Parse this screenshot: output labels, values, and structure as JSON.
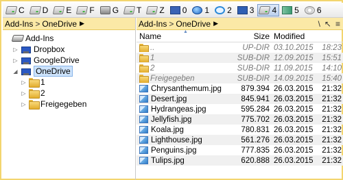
{
  "drives": [
    {
      "letter": "C",
      "icon": "hdd-icon"
    },
    {
      "letter": "D",
      "icon": "hdd-icon"
    },
    {
      "letter": "E",
      "icon": "hdd-icon"
    },
    {
      "letter": "F",
      "icon": "hdd-icon"
    },
    {
      "letter": "G",
      "icon": "printer-icon"
    },
    {
      "letter": "T",
      "icon": "hdd-icon"
    },
    {
      "letter": "Z",
      "icon": "hdd-icon"
    },
    {
      "letter": "0",
      "icon": "network-drive-icon"
    },
    {
      "letter": "1",
      "icon": "globe-icon"
    },
    {
      "letter": "2",
      "icon": "internet-explorer-icon"
    },
    {
      "letter": "3",
      "icon": "monitor-icon"
    },
    {
      "letter": "4",
      "icon": "hdd-icon"
    },
    {
      "letter": "5",
      "icon": "book-icon"
    },
    {
      "letter": "6",
      "icon": "disc-icon"
    }
  ],
  "active_drive": "4",
  "left": {
    "path": [
      "Add-Ins",
      "OneDrive"
    ],
    "tree": [
      {
        "label": "Add-Ins",
        "level": 0,
        "icon": "addins-icon",
        "expander": ""
      },
      {
        "label": "Dropbox",
        "level": 1,
        "icon": "cloud-drive-icon",
        "expander": "▷"
      },
      {
        "label": "GoogleDrive",
        "level": 1,
        "icon": "cloud-drive-icon",
        "expander": "▷"
      },
      {
        "label": "OneDrive",
        "level": 1,
        "icon": "cloud-drive-icon",
        "expander": "◢",
        "selected": true
      },
      {
        "label": "1",
        "level": 2,
        "icon": "folder-icon",
        "expander": "▷"
      },
      {
        "label": "2",
        "level": 2,
        "icon": "folder-icon",
        "expander": "▷"
      },
      {
        "label": "Freigegeben",
        "level": 2,
        "icon": "folder-icon",
        "expander": "▷"
      }
    ]
  },
  "right": {
    "toolbar_icons": [
      "\\",
      "↖",
      "≡"
    ],
    "columns": {
      "name": "Name",
      "size": "Size",
      "modified": "Modified"
    },
    "rows": [
      {
        "name": "..",
        "size": "UP-DIR",
        "date": "03.10.2015",
        "time": "18:23",
        "kind": "dir"
      },
      {
        "name": "1",
        "size": "SUB-DIR",
        "date": "12.09.2015",
        "time": "15:51",
        "kind": "dir"
      },
      {
        "name": "2",
        "size": "SUB-DIR",
        "date": "11.09.2015",
        "time": "14:10",
        "kind": "dir"
      },
      {
        "name": "Freigegeben",
        "size": "SUB-DIR",
        "date": "14.09.2015",
        "time": "15:40",
        "kind": "dir"
      },
      {
        "name": "Chrysanthemum.jpg",
        "size": "879.394",
        "date": "26.03.2015",
        "time": "21:32",
        "kind": "file"
      },
      {
        "name": "Desert.jpg",
        "size": "845.941",
        "date": "26.03.2015",
        "time": "21:32",
        "kind": "file"
      },
      {
        "name": "Hydrangeas.jpg",
        "size": "595.284",
        "date": "26.03.2015",
        "time": "21:32",
        "kind": "file"
      },
      {
        "name": "Jellyfish.jpg",
        "size": "775.702",
        "date": "26.03.2015",
        "time": "21:32",
        "kind": "file"
      },
      {
        "name": "Koala.jpg",
        "size": "780.831",
        "date": "26.03.2015",
        "time": "21:32",
        "kind": "file"
      },
      {
        "name": "Lighthouse.jpg",
        "size": "561.276",
        "date": "26.03.2015",
        "time": "21:32",
        "kind": "file"
      },
      {
        "name": "Penguins.jpg",
        "size": "777.835",
        "date": "26.03.2015",
        "time": "21:32",
        "kind": "file"
      },
      {
        "name": "Tulips.jpg",
        "size": "620.888",
        "date": "26.03.2015",
        "time": "21:32",
        "kind": "file"
      }
    ]
  },
  "colors": {
    "frame": "#f3d56e",
    "pathbar": "#fbe9a6",
    "selection": "#cde3fb",
    "dir_text": "#7a7a7a"
  }
}
